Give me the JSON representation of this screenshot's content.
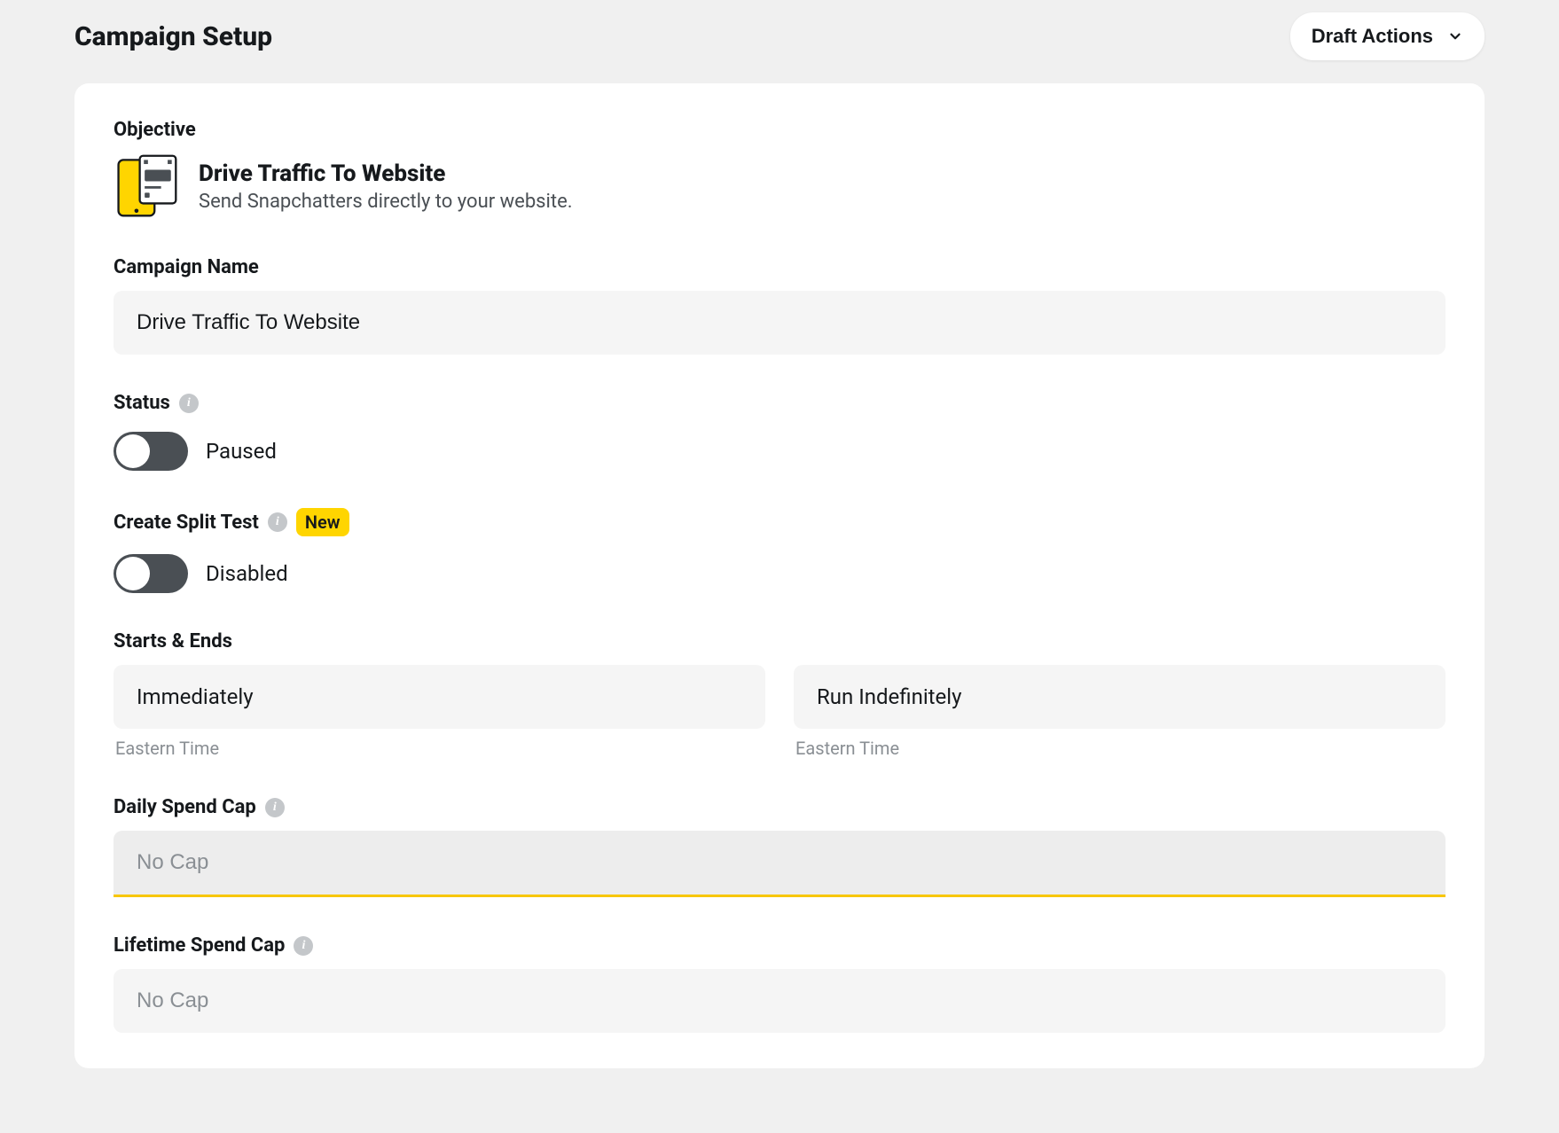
{
  "header": {
    "title": "Campaign Setup",
    "draft_actions_label": "Draft Actions"
  },
  "objective": {
    "section_label": "Objective",
    "title": "Drive Traffic To Website",
    "description": "Send Snapchatters directly to your website."
  },
  "campaign_name": {
    "label": "Campaign Name",
    "value": "Drive Traffic To Website"
  },
  "status": {
    "label": "Status",
    "value": "Paused"
  },
  "split_test": {
    "label": "Create Split Test",
    "badge": "New",
    "value": "Disabled"
  },
  "starts_ends": {
    "label": "Starts & Ends",
    "start_value": "Immediately",
    "end_value": "Run Indefinitely",
    "start_helper": "Eastern Time",
    "end_helper": "Eastern Time"
  },
  "daily_cap": {
    "label": "Daily Spend Cap",
    "placeholder": "No Cap",
    "value": ""
  },
  "lifetime_cap": {
    "label": "Lifetime Spend Cap",
    "placeholder": "No Cap",
    "value": ""
  }
}
